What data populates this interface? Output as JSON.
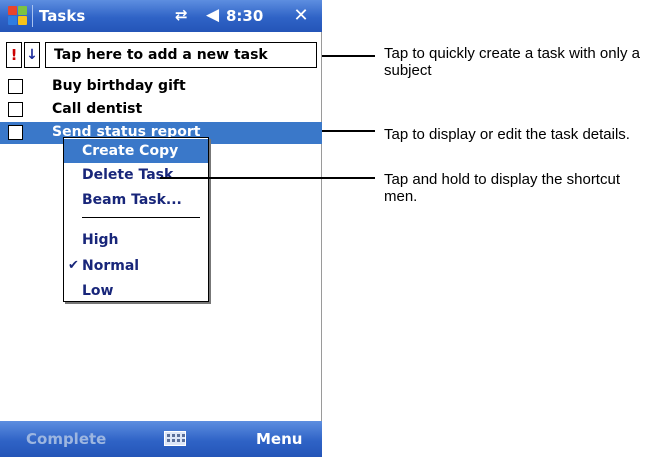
{
  "titlebar": {
    "app_title": "Tasks",
    "clock": "8:30",
    "close_label": "✕",
    "connectivity_glyph": "⇄",
    "volume_glyph": "◀"
  },
  "entrybar": {
    "priority_glyph": "!",
    "low_glyph": "↓",
    "new_task_placeholder": "Tap here to add a new task"
  },
  "tasks": [
    {
      "subject": "Buy birthday gift",
      "selected": false
    },
    {
      "subject": "Call dentist",
      "selected": false
    },
    {
      "subject": "Send status report",
      "selected": true
    }
  ],
  "context_menu": {
    "items": [
      "Create Copy",
      "Delete Task",
      "Beam Task..."
    ],
    "priority_items": [
      "High",
      "Normal",
      "Low"
    ],
    "checked_priority": "Normal",
    "check_glyph": "✔"
  },
  "bottombar": {
    "left_softkey": "Complete",
    "right_softkey": "Menu"
  },
  "callouts": [
    "Tap to quickly create a task with only a subject",
    "Tap to display or edit the task details.",
    "Tap and hold to display the shortcut men."
  ],
  "colors": {
    "titlebar_blue": "#2f63c6",
    "selection_blue": "#3a78c9",
    "priority_red": "#cc0000"
  }
}
